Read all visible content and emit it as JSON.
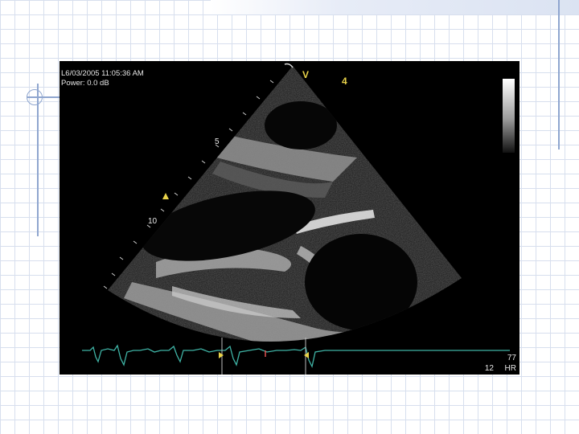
{
  "slide": {
    "accent_color": "#8fa6cf",
    "grid_color": "#d7dfee"
  },
  "echo": {
    "timestamp": "L6/03/2005 11:05:36 AM",
    "power": "Power: 0.0 dB",
    "marker_v": "V",
    "marker_4": "4",
    "depth_5": "5",
    "depth_10": "10",
    "hr_value": "77",
    "hr_label": "HR",
    "bottom_num": "12",
    "ecg_color": "#3fb3a5"
  }
}
